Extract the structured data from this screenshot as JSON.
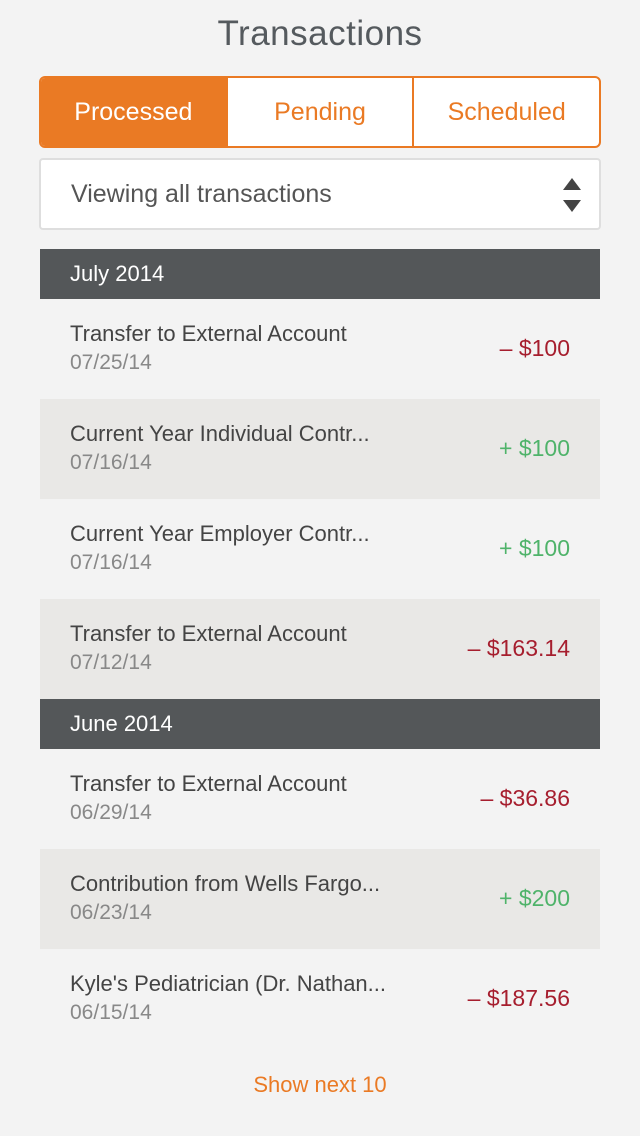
{
  "header": {
    "title": "Transactions"
  },
  "tabs": [
    {
      "label": "Processed",
      "active": true
    },
    {
      "label": "Pending",
      "active": false
    },
    {
      "label": "Scheduled",
      "active": false
    }
  ],
  "filter": {
    "selected": "Viewing all transactions"
  },
  "sections": [
    {
      "title": "July 2014",
      "transactions": [
        {
          "description": "Transfer to External Account",
          "date": "07/25/14",
          "amount": "– $100",
          "direction": "negative"
        },
        {
          "description": "Current Year Individual Contr...",
          "date": "07/16/14",
          "amount": "+ $100",
          "direction": "positive"
        },
        {
          "description": "Current Year Employer Contr...",
          "date": "07/16/14",
          "amount": "+ $100",
          "direction": "positive"
        },
        {
          "description": "Transfer to External Account",
          "date": "07/12/14",
          "amount": "– $163.14",
          "direction": "negative"
        }
      ]
    },
    {
      "title": "June 2014",
      "transactions": [
        {
          "description": "Transfer to External Account",
          "date": "06/29/14",
          "amount": "– $36.86",
          "direction": "negative"
        },
        {
          "description": "Contribution from Wells Fargo...",
          "date": "06/23/14",
          "amount": "+ $200",
          "direction": "positive"
        },
        {
          "description": "Kyle's Pediatrician (Dr. Nathan...",
          "date": "06/15/14",
          "amount": "– $187.56",
          "direction": "negative"
        }
      ]
    }
  ],
  "footer": {
    "show_more_label": "Show next 10"
  },
  "colors": {
    "accent": "#ea7a24",
    "negative": "#a61e2e",
    "positive": "#4fb36a",
    "section_header": "#545759"
  }
}
